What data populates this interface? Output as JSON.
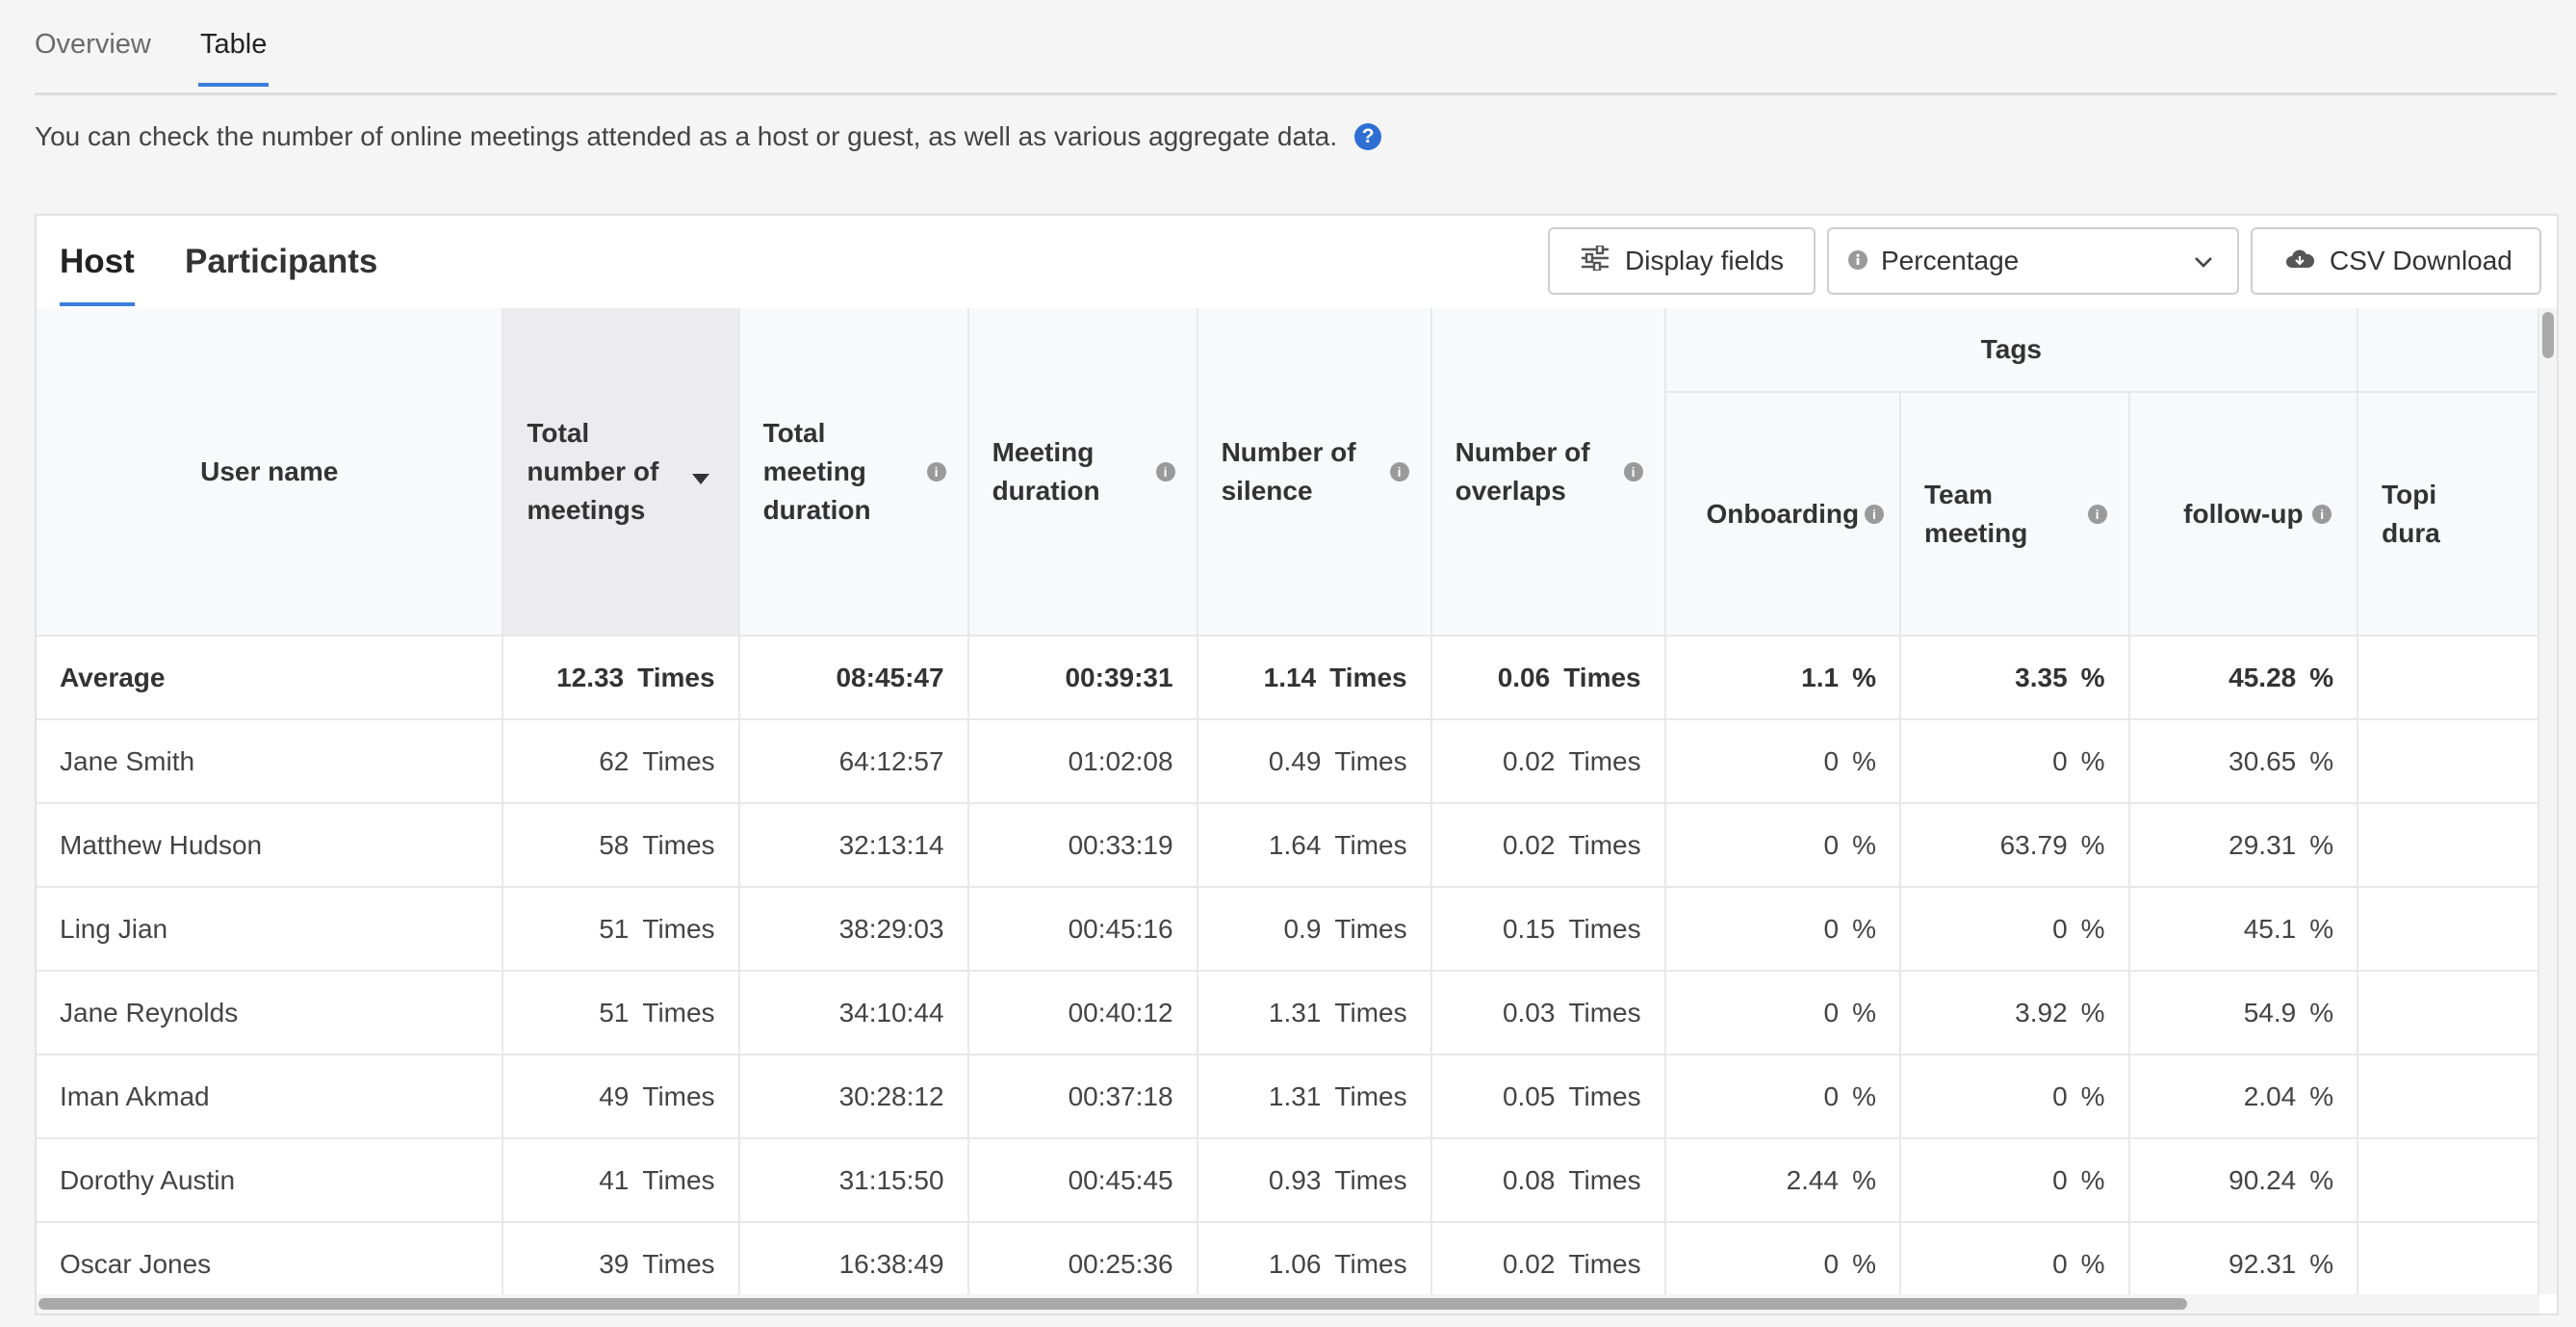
{
  "tabs": [
    {
      "label": "Overview"
    },
    {
      "label": "Table"
    }
  ],
  "description": "You can check the number of online meetings attended as a host or guest, as well as various aggregate data.",
  "help_icon": "?",
  "panel": {
    "tabs": [
      {
        "label": "Host"
      },
      {
        "label": "Participants"
      }
    ],
    "display_fields_label": "Display fields",
    "mode_select_value": "Percentage",
    "csv_label": "CSV Download"
  },
  "columns": {
    "user_name": "User name",
    "total_meetings": [
      "Total",
      "number of",
      "meetings"
    ],
    "total_duration": [
      "Total",
      "meeting",
      "duration"
    ],
    "meeting_duration": [
      "Meeting",
      "duration"
    ],
    "silence": [
      "Number of",
      "silence"
    ],
    "overlaps": [
      "Number of",
      "overlaps"
    ],
    "tags_group": "Tags",
    "onboarding": "Onboarding",
    "team_meeting": [
      "Team",
      "meeting"
    ],
    "follow_up": "follow-up",
    "topic_duration": [
      "Topi",
      "dura"
    ]
  },
  "units": {
    "times": "Times",
    "percent": "%"
  },
  "average": {
    "name": "Average",
    "meetings": "12.33",
    "total": "08:45:47",
    "duration": "00:39:31",
    "silence": "1.14",
    "overlaps": "0.06",
    "onboarding": "1.1",
    "team": "3.35",
    "follow": "45.28"
  },
  "rows": [
    {
      "name": "Jane Smith",
      "meetings": "62",
      "total": "64:12:57",
      "duration": "01:02:08",
      "silence": "0.49",
      "overlaps": "0.02",
      "onboarding": "0",
      "team": "0",
      "follow": "30.65"
    },
    {
      "name": "Matthew Hudson",
      "meetings": "58",
      "total": "32:13:14",
      "duration": "00:33:19",
      "silence": "1.64",
      "overlaps": "0.02",
      "onboarding": "0",
      "team": "63.79",
      "follow": "29.31"
    },
    {
      "name": "Ling Jian",
      "meetings": "51",
      "total": "38:29:03",
      "duration": "00:45:16",
      "silence": "0.9",
      "overlaps": "0.15",
      "onboarding": "0",
      "team": "0",
      "follow": "45.1"
    },
    {
      "name": "Jane Reynolds",
      "meetings": "51",
      "total": "34:10:44",
      "duration": "00:40:12",
      "silence": "1.31",
      "overlaps": "0.03",
      "onboarding": "0",
      "team": "3.92",
      "follow": "54.9"
    },
    {
      "name": "Iman Akmad",
      "meetings": "49",
      "total": "30:28:12",
      "duration": "00:37:18",
      "silence": "1.31",
      "overlaps": "0.05",
      "onboarding": "0",
      "team": "0",
      "follow": "2.04"
    },
    {
      "name": "Dorothy Austin",
      "meetings": "41",
      "total": "31:15:50",
      "duration": "00:45:45",
      "silence": "0.93",
      "overlaps": "0.08",
      "onboarding": "2.44",
      "team": "0",
      "follow": "90.24"
    },
    {
      "name": "Oscar Jones",
      "meetings": "39",
      "total": "16:38:49",
      "duration": "00:25:36",
      "silence": "1.06",
      "overlaps": "0.02",
      "onboarding": "0",
      "team": "0",
      "follow": "92.31"
    }
  ]
}
